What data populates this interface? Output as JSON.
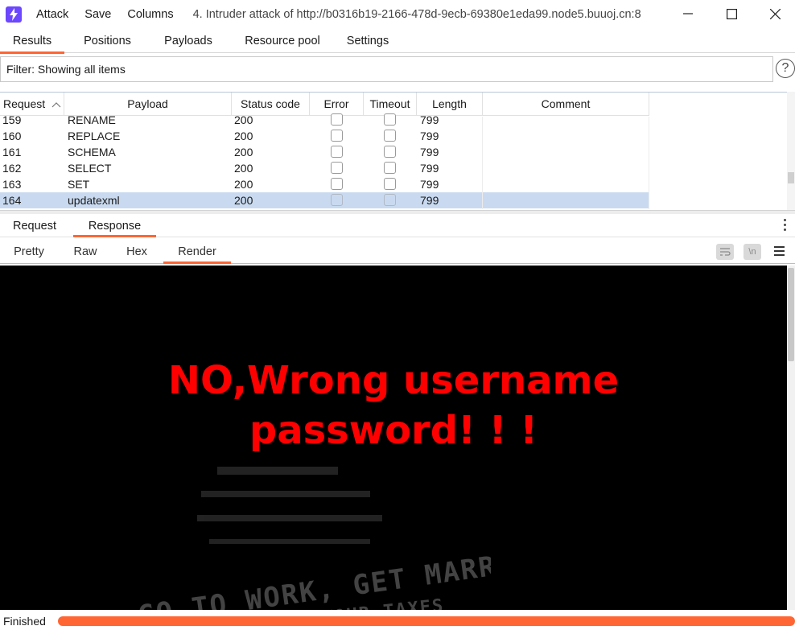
{
  "titlebar": {
    "menu": [
      "Attack",
      "Save",
      "Columns"
    ],
    "title": "4. Intruder attack of http://b0316b19-2166-478d-9ecb-69380e1eda99.node5.buuoj.cn:8"
  },
  "main_tabs": [
    {
      "label": "Results",
      "active": true
    },
    {
      "label": "Positions",
      "active": false
    },
    {
      "label": "Payloads",
      "active": false
    },
    {
      "label": "Resource pool",
      "active": false
    },
    {
      "label": "Settings",
      "active": false
    }
  ],
  "filter": {
    "text": "Filter: Showing all items",
    "help": "?"
  },
  "table": {
    "columns": [
      "Request",
      "Payload",
      "Status code",
      "Error",
      "Timeout",
      "Length",
      "Comment"
    ],
    "sort_indicator": "^",
    "rows": [
      {
        "request": "159",
        "payload": "RENAME",
        "status": "200",
        "error": false,
        "timeout": false,
        "length": "799",
        "comment": ""
      },
      {
        "request": "160",
        "payload": "REPLACE",
        "status": "200",
        "error": false,
        "timeout": false,
        "length": "799",
        "comment": ""
      },
      {
        "request": "161",
        "payload": "SCHEMA",
        "status": "200",
        "error": false,
        "timeout": false,
        "length": "799",
        "comment": ""
      },
      {
        "request": "162",
        "payload": "SELECT",
        "status": "200",
        "error": false,
        "timeout": false,
        "length": "799",
        "comment": ""
      },
      {
        "request": "163",
        "payload": "SET",
        "status": "200",
        "error": false,
        "timeout": false,
        "length": "799",
        "comment": ""
      },
      {
        "request": "164",
        "payload": "updatexml",
        "status": "200",
        "error": false,
        "timeout": false,
        "length": "799",
        "comment": "",
        "selected": true
      }
    ]
  },
  "rr_tabs": [
    {
      "label": "Request",
      "active": false
    },
    {
      "label": "Response",
      "active": true
    }
  ],
  "view_tabs": [
    {
      "label": "Pretty",
      "active": false
    },
    {
      "label": "Raw",
      "active": false
    },
    {
      "label": "Hex",
      "active": false
    },
    {
      "label": "Render",
      "active": true
    }
  ],
  "view_tools": {
    "wrap_icon": "wrap-lines-icon",
    "newline_label": "\\n",
    "menu_icon": "hamburger-menu-icon"
  },
  "render": {
    "line1": "NO,Wrong username",
    "line2": "password! ! !",
    "message_color": "#ff0000",
    "background_color": "#000000"
  },
  "status": {
    "text": "Finished",
    "progress": 1.0,
    "progress_color": "#ff6633"
  },
  "colors": {
    "accent": "#ff6633",
    "selected_row": "#c9daf0",
    "app_icon": "#6c47ff"
  }
}
